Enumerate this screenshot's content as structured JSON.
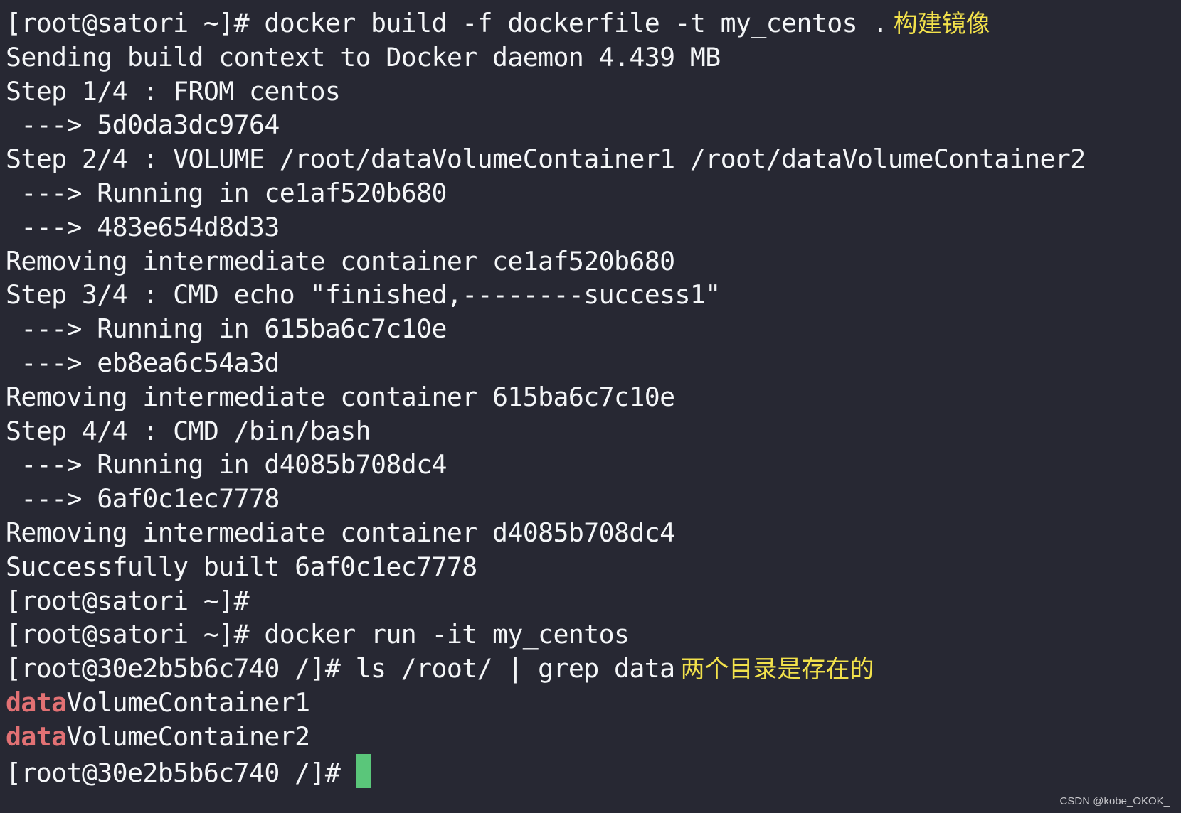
{
  "terminal": {
    "lines": [
      {
        "text": "[root@satori ~]# docker build -f dockerfile -t my_centos .",
        "note": "构建镜像"
      },
      {
        "text": "Sending build context to Docker daemon 4.439 MB"
      },
      {
        "text": "Step 1/4 : FROM centos"
      },
      {
        "text": " ---> 5d0da3dc9764"
      },
      {
        "text": "Step 2/4 : VOLUME /root/dataVolumeContainer1 /root/dataVolumeContainer2"
      },
      {
        "text": " ---> Running in ce1af520b680"
      },
      {
        "text": " ---> 483e654d8d33"
      },
      {
        "text": "Removing intermediate container ce1af520b680"
      },
      {
        "text": "Step 3/4 : CMD echo \"finished,--------success1\""
      },
      {
        "text": " ---> Running in 615ba6c7c10e"
      },
      {
        "text": " ---> eb8ea6c54a3d"
      },
      {
        "text": "Removing intermediate container 615ba6c7c10e"
      },
      {
        "text": "Step 4/4 : CMD /bin/bash"
      },
      {
        "text": " ---> Running in d4085b708dc4"
      },
      {
        "text": " ---> 6af0c1ec7778"
      },
      {
        "text": "Removing intermediate container d4085b708dc4"
      },
      {
        "text": "Successfully built 6af0c1ec7778"
      },
      {
        "text": "[root@satori ~]#"
      },
      {
        "text": "[root@satori ~]# docker run -it my_centos"
      },
      {
        "text": "[root@30e2b5b6c740 /]# ls /root/ | grep data",
        "note": "两个目录是存在的"
      },
      {
        "highlight": "data",
        "text": "VolumeContainer1"
      },
      {
        "highlight": "data",
        "text": "VolumeContainer2"
      },
      {
        "text": "[root@30e2b5b6c740 /]# ",
        "cursor": true
      }
    ]
  },
  "colors": {
    "background": "#272833",
    "text": "#f4f6f8",
    "annotation": "#f2e14b",
    "grep_match": "#e27174",
    "cursor": "#5ac67a"
  },
  "watermark": "CSDN @kobe_OKOK_"
}
